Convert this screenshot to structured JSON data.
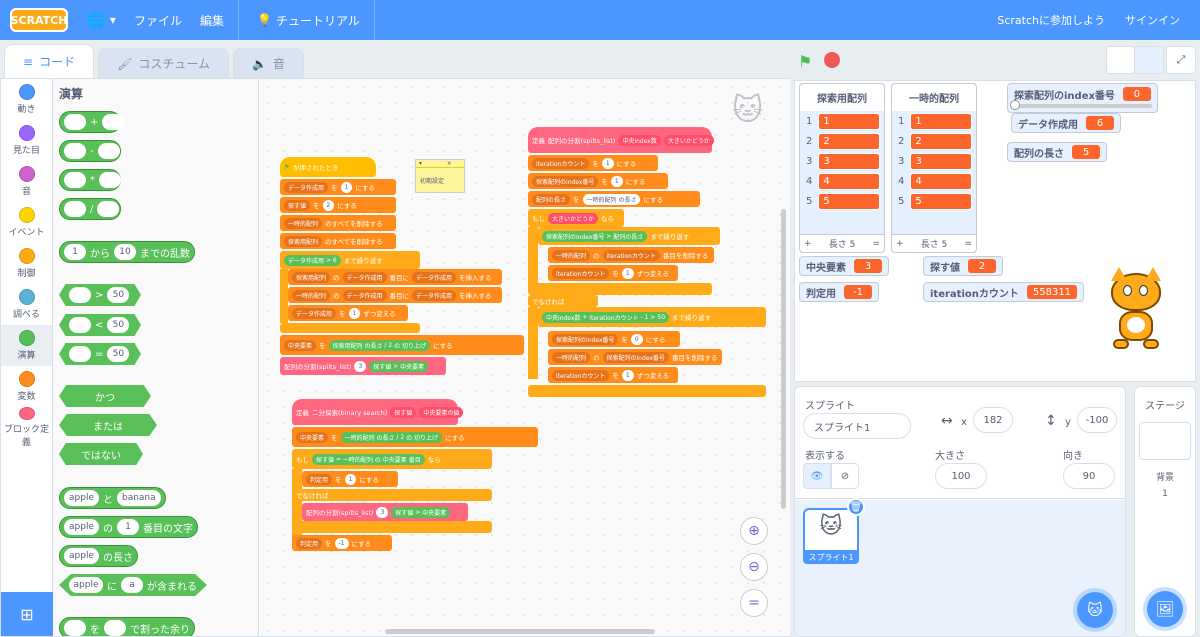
{
  "menubar": {
    "logo": "SCRATCH",
    "file": "ファイル",
    "edit": "編集",
    "tutorial": "チュートリアル",
    "join": "Scratchに参加しよう",
    "signin": "サインイン"
  },
  "tabs": {
    "code": "コード",
    "costume": "コスチューム",
    "sound": "音"
  },
  "categories": [
    {
      "label": "動き",
      "color": "#4c97ff"
    },
    {
      "label": "見た目",
      "color": "#9966ff"
    },
    {
      "label": "音",
      "color": "#cf63cf"
    },
    {
      "label": "イベント",
      "color": "#ffd500"
    },
    {
      "label": "制御",
      "color": "#ffab19"
    },
    {
      "label": "調べる",
      "color": "#5cb1d6"
    },
    {
      "label": "演算",
      "color": "#59c059"
    },
    {
      "label": "変数",
      "color": "#ff8c1a"
    },
    {
      "label": "ブロック定義",
      "color": "#ff6680"
    }
  ],
  "palette": {
    "title": "演算",
    "plus": "+",
    "minus": "-",
    "times": "*",
    "divide": "/",
    "random_from": "から",
    "random_to": "までの乱数",
    "random_a": "1",
    "random_b": "10",
    "gt": ">",
    "lt": "<",
    "eq": "=",
    "fifty": "50",
    "and": "かつ",
    "or": "または",
    "not": "ではない",
    "apple": "apple",
    "and_join": "と",
    "banana": "banana",
    "of": "の",
    "one": "1",
    "letter": "番目の文字",
    "length": "の長さ",
    "ni": "に",
    "a": "a",
    "contains": "が含まれる",
    "wo": "を",
    "mod": "で割った余り"
  },
  "script1": {
    "hat": "が押されたとき",
    "note": "初期設定",
    "b1": "データ作成用",
    "b1s": "を",
    "b1v": "1",
    "b1e": "にする",
    "b2": "探す値",
    "b2v": "2",
    "b3": "一時的配列",
    "b3e": "のすべてを削除する",
    "b4": "探索用配列",
    "rep": "データ作成用",
    "repv": "6",
    "repe": "まで繰り返す",
    "ins1a": "探索用配列",
    "ins1b": "の",
    "ins1c": "データ作成用",
    "ins1d": "番目に",
    "ins1e": "データ作成用",
    "ins1f": "を挿入する",
    "ins2a": "一時的配列",
    "chg": "データ作成用",
    "chgv": "1",
    "chge": "ずつ変える",
    "mid": "中央要素",
    "mida": "探索用配列",
    "midb": "の長さ",
    "midc": "/",
    "midd": "2",
    "mide": "の",
    "midf": "切り上げ",
    "midg": "にする",
    "call": "配列の分割(spilts_list)",
    "callv": "3",
    "callb": "探す値",
    "callc": ">",
    "calld": "中央要素"
  },
  "script2": {
    "def": "定義",
    "defname": "配列の分割(spilts_list)",
    "p1": "中央index数",
    "p2": "大きいかどうか",
    "a1": "iterationカウント",
    "a1v": "1",
    "a1e": "にする",
    "a2": "探索配列のindex番号",
    "a2v": "1",
    "a3": "配列の長さ",
    "a3b": "一時的配列",
    "a3c": "の長さ",
    "if": "もし",
    "cond": "大きいかどうか",
    "then": "なら",
    "r1": "探索配列のindex番号",
    "r1b": ">",
    "r1c": "配列の長さ",
    "r1d": "まで繰り返す",
    "d1": "一時的配列",
    "d1b": "の",
    "d1c": "iterationカウント",
    "d1d": "番目を削除する",
    "c1": "iterationカウント",
    "c1v": "1",
    "c1e": "ずつ変える",
    "else": "でなければ",
    "r2a": "中央index数",
    "r2b": "+",
    "r2c": "iterationカウント",
    "r2d": "-",
    "r2e": "1",
    "r2f": ">",
    "r2g": "50",
    "r2h": "まで繰り返す",
    "s1": "探索配列のindex番号",
    "s1v": "0",
    "d2": "一時的配列",
    "d2c": "探索配列のindex番号"
  },
  "script3": {
    "def": "定義",
    "name": "二分探索(binary search)",
    "p1": "探す値",
    "p2": "中央要素の値",
    "m1": "中央要素",
    "m1a": "一時的配列",
    "m1b": "の長さ",
    "m1c": "/",
    "m1d": "2",
    "m1e": "の",
    "m1f": "切り上げ",
    "m1g": "にする",
    "if": "もし",
    "c1": "探す値",
    "c2": "=",
    "c3": "一時的配列",
    "c4": "の",
    "c5": "中央要素",
    "c6": "番目",
    "then": "なら",
    "j1": "判定用",
    "j1v": "1",
    "j1e": "にする",
    "else": "でなければ",
    "call": "配列の分割(spilts_list)",
    "callv": "3",
    "callb": "探す値",
    "callc": ">",
    "calld": "中央要素",
    "j2": "判定用",
    "j2v": "-1"
  },
  "stage": {
    "list1": {
      "title": "探索用配列",
      "items": [
        "1",
        "2",
        "3",
        "4",
        "5"
      ],
      "vals": [
        "1",
        "2",
        "3",
        "4",
        "5"
      ],
      "plus": "+",
      "len": "長さ 5",
      "eq": "="
    },
    "list2": {
      "title": "一時的配列",
      "items": [
        "1",
        "2",
        "3",
        "4",
        "5"
      ],
      "vals": [
        "1",
        "2",
        "3",
        "4",
        "5"
      ],
      "plus": "+",
      "len": "長さ 5",
      "eq": "="
    },
    "mon_index": {
      "label": "探索配列のindex番号",
      "value": "0"
    },
    "mon_data": {
      "label": "データ作成用",
      "value": "6"
    },
    "mon_len": {
      "label": "配列の長さ",
      "value": "5"
    },
    "mon_mid": {
      "label": "中央要素",
      "value": "3"
    },
    "mon_search": {
      "label": "探す値",
      "value": "2"
    },
    "mon_judge": {
      "label": "判定用",
      "value": "-1"
    },
    "mon_iter": {
      "label": "iterationカウント",
      "value": "558311"
    }
  },
  "sprite": {
    "label": "スプライト",
    "name": "スプライト1",
    "x_label": "x",
    "x": "182",
    "y_label": "y",
    "y": "-100",
    "show": "表示する",
    "size_label": "大きさ",
    "size": "100",
    "dir_label": "向き",
    "dir": "90",
    "thumb": "スプライト1"
  },
  "stagepane": {
    "title": "ステージ",
    "bg": "背景",
    "count": "1"
  }
}
